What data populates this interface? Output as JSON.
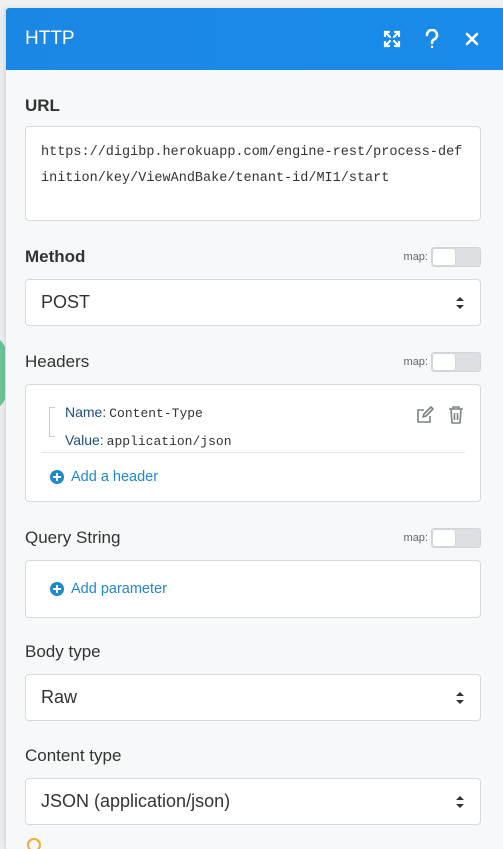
{
  "header": {
    "title": "HTTP",
    "expand_icon": "expand-icon",
    "help_icon": "question-mark-icon",
    "close_icon": "close-icon",
    "color": "#1b87e5"
  },
  "url": {
    "label": "URL",
    "value": "https://digibp.herokuapp.com/engine-rest/process-definition/key/ViewAndBake/tenant-id/MI1/start"
  },
  "method": {
    "label": "Method",
    "map_label": "map:",
    "value": "POST"
  },
  "headers": {
    "label": "Headers",
    "map_label": "map:",
    "items": [
      {
        "name_label": "Name:",
        "name": "Content-Type",
        "value_label": "Value:",
        "value": "application/json"
      }
    ],
    "add_label": "Add a header"
  },
  "query_string": {
    "label": "Query String",
    "map_label": "map:",
    "add_label": "Add parameter"
  },
  "body_type": {
    "label": "Body type",
    "value": "Raw"
  },
  "content_type": {
    "label": "Content type",
    "value": "JSON (application/json)"
  },
  "colors": {
    "link": "#1e88cc",
    "warning": "#f0ad2e"
  }
}
